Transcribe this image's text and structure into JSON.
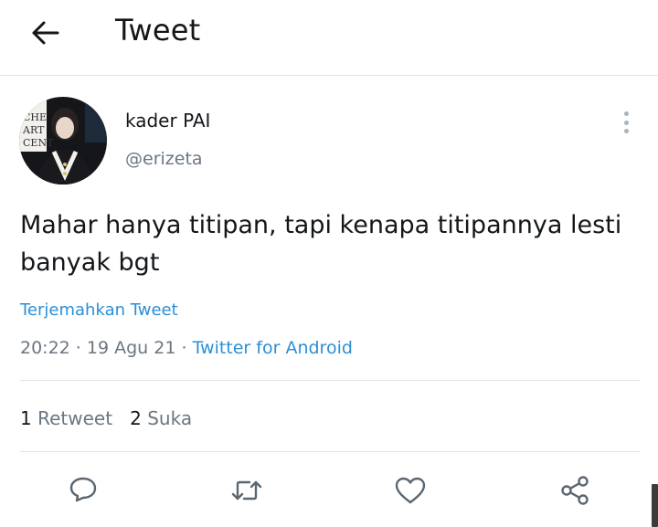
{
  "header": {
    "title": "Tweet",
    "back_icon": "arrow-left-icon"
  },
  "author": {
    "display_name": "kader PAI",
    "handle": "@erizeta",
    "avatar_backdrop_text": [
      "CHE",
      "ART",
      "CENT"
    ]
  },
  "tweet": {
    "text": "Mahar hanya titipan, tapi kenapa titipannya lesti banyak bgt",
    "translate_label": "Terjemahkan Tweet",
    "time": "20:22",
    "date": "19 Agu 21",
    "separator": " · ",
    "source": "Twitter for Android"
  },
  "stats": {
    "retweet_count": "1",
    "retweet_label": "Retweet",
    "like_count": "2",
    "like_label": "Suka"
  },
  "actions": [
    {
      "name": "reply",
      "icon": "reply-icon"
    },
    {
      "name": "retweet",
      "icon": "retweet-icon"
    },
    {
      "name": "like",
      "icon": "heart-icon"
    },
    {
      "name": "share",
      "icon": "share-icon"
    }
  ],
  "colors": {
    "text": "#14171a",
    "secondary": "#6b7680",
    "link": "#2a8fd6",
    "divider": "#e1e4e6"
  }
}
